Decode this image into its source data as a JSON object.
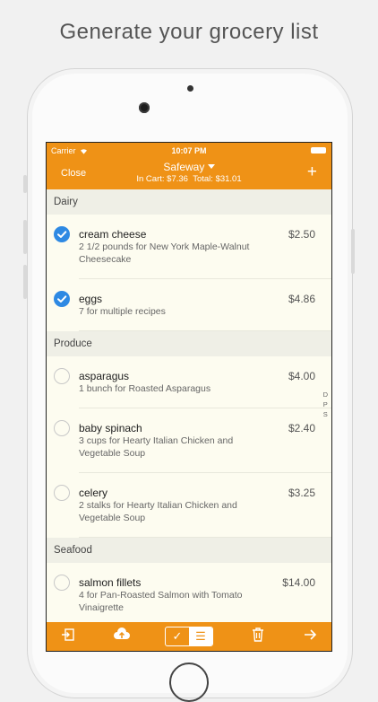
{
  "headline": "Generate your grocery list",
  "status": {
    "carrier": "Carrier",
    "time": "10:07 PM"
  },
  "nav": {
    "close": "Close",
    "title": "Safeway",
    "cart": "In Cart: $7.36",
    "total": "Total: $31.01",
    "add_icon": "plus-icon"
  },
  "sections": [
    {
      "name": "Dairy",
      "items": [
        {
          "name": "cream cheese",
          "desc": "2 1/2 pounds for New York Maple-Walnut Cheesecake",
          "price": "$2.50",
          "checked": true
        },
        {
          "name": "eggs",
          "desc": "7 for multiple recipes",
          "price": "$4.86",
          "checked": true
        }
      ]
    },
    {
      "name": "Produce",
      "items": [
        {
          "name": "asparagus",
          "desc": "1 bunch for Roasted Asparagus",
          "price": "$4.00",
          "checked": false
        },
        {
          "name": "baby spinach",
          "desc": "3 cups for Hearty Italian Chicken and Vegetable Soup",
          "price": "$2.40",
          "checked": false
        },
        {
          "name": "celery",
          "desc": "2 stalks for Hearty Italian Chicken and Vegetable Soup",
          "price": "$3.25",
          "checked": false
        }
      ]
    },
    {
      "name": "Seafood",
      "items": [
        {
          "name": "salmon fillets",
          "desc": "4 for Pan-Roasted Salmon with Tomato Vinaigrette",
          "price": "$14.00",
          "checked": false
        }
      ]
    }
  ],
  "index_letters": [
    "D",
    "P",
    "S"
  ],
  "toolbar": {
    "icons": [
      "import-icon",
      "cloud-upload-icon",
      "checkmark-icon",
      "list-icon",
      "trash-icon",
      "arrow-right-icon"
    ]
  },
  "colors": {
    "accent": "#ef9216",
    "check": "#2e89e3",
    "background": "#fdfcf0"
  }
}
